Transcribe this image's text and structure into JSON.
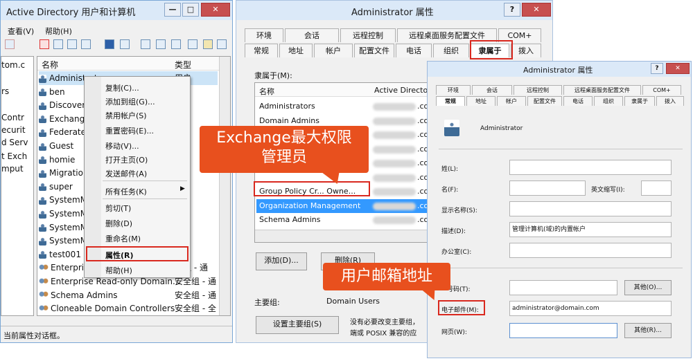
{
  "ad_window": {
    "title": "Active Directory 用户和计算机",
    "menu": [
      "查看(V)",
      "帮助(H)"
    ],
    "tree_items": [
      "tom.c",
      "rs",
      "Contr",
      "ecurit",
      "d Serv",
      "t Exch",
      "mput"
    ],
    "columns": [
      "名称",
      "类型"
    ],
    "rows": [
      {
        "name": "Administrator",
        "type": "用户",
        "group": false
      },
      {
        "name": "ben",
        "type": "",
        "group": false
      },
      {
        "name": "Discover",
        "type": "",
        "group": false
      },
      {
        "name": "Exchange",
        "type": "",
        "group": false
      },
      {
        "name": "Federate",
        "type": "",
        "group": false
      },
      {
        "name": "Guest",
        "type": "",
        "group": false
      },
      {
        "name": "homie",
        "type": "",
        "group": false
      },
      {
        "name": "Migratio",
        "type": "",
        "group": false
      },
      {
        "name": "super",
        "type": "",
        "group": false
      },
      {
        "name": "SystemM",
        "type": "",
        "group": false
      },
      {
        "name": "SystemM",
        "type": "",
        "group": false
      },
      {
        "name": "SystemM",
        "type": "",
        "group": false
      },
      {
        "name": "SystemM",
        "type": "",
        "group": false
      },
      {
        "name": "test001",
        "type": "",
        "group": false
      },
      {
        "name": "Enterpris",
        "type": "全组 - 通",
        "group": true
      },
      {
        "name": "Enterprise Read-only Domain...",
        "type": "安全组 - 通",
        "group": true
      },
      {
        "name": "Schema Admins",
        "type": "安全组 - 通",
        "group": true
      },
      {
        "name": "Cloneable Domain Controllers",
        "type": "安全组 - 全",
        "group": true
      }
    ],
    "status": "当前属性对话框。"
  },
  "context_menu": {
    "items": [
      "复制(C)...",
      "添加到组(G)...",
      "禁用帐户(S)",
      "重置密码(E)...",
      "移动(V)...",
      "打开主页(O)",
      "发送邮件(A)",
      "所有任务(K)",
      "剪切(T)",
      "删除(D)",
      "重命名(M)",
      "属性(R)",
      "帮助(H)"
    ]
  },
  "props_back": {
    "title": "Administrator 属性",
    "tabs_row1": [
      "环境",
      "会话",
      "远程控制",
      "远程桌面服务配置文件",
      "COM+"
    ],
    "tabs_row2": [
      "常规",
      "地址",
      "帐户",
      "配置文件",
      "电话",
      "组织",
      "隶属于",
      "拨入"
    ],
    "member_of_label": "隶属于(M):",
    "columns": [
      "名称",
      "Active Directo"
    ],
    "groups": [
      "Administrators",
      "Domain Admins",
      "",
      "",
      "",
      "",
      "Group Policy Cr... Owne...",
      "Organization Management",
      "Schema Admins"
    ],
    "group_suffix": ".co",
    "add_button": "添加(D)...",
    "remove_button": "删除(R)",
    "primary_group_label": "主要组:",
    "primary_group_value": "Domain Users",
    "set_primary_button": "设置主要组(S)",
    "note_line1": "没有必要改变主要组，",
    "note_line2": "端或 POSIX 兼容的应"
  },
  "props_front": {
    "title": "Administrator 属性",
    "tabs_row1": [
      "环境",
      "会话",
      "远程控制",
      "远程桌面服务配置文件",
      "COM+"
    ],
    "tabs_row2": [
      "常规",
      "地址",
      "帐户",
      "配置文件",
      "电话",
      "组织",
      "隶属于",
      "拨入"
    ],
    "user_name": "Administrator",
    "labels": {
      "last_name": "姓(L):",
      "first_name": "名(F):",
      "initials": "英文缩写(I):",
      "display_name": "显示名称(S):",
      "description": "描述(D):",
      "office": "办公室(C):",
      "phone": "号码(T):",
      "email": "电子邮件(M):",
      "web": "网页(W):"
    },
    "description_value": "管理计算机(域)的内置帐户",
    "email_value": "administrator@domain.com",
    "other_button": "其他(O)...",
    "other_button2": "其他(R)..."
  },
  "callouts": {
    "exchange_admin": [
      "Exchange最大权限",
      "管理员"
    ],
    "user_mailbox": "用户邮箱地址"
  },
  "colors": {
    "accent": "#e8501e",
    "highlight_red": "#d9281e",
    "selection": "#3399ff"
  }
}
